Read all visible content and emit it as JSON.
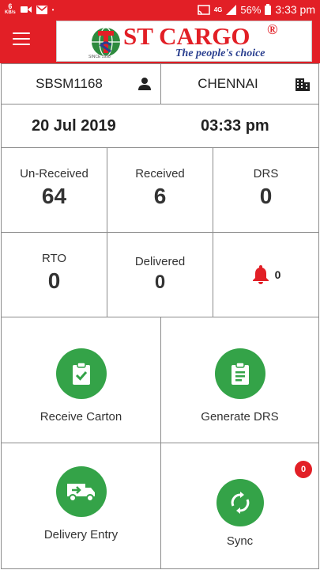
{
  "status_bar": {
    "net_speed": "6",
    "net_speed_unit": "KB/s",
    "network": "4G",
    "battery": "56%",
    "time": "3:33 pm"
  },
  "app_bar": {
    "logo_text": "ST CARGO",
    "logo_reg": "®",
    "logo_tagline": "The people's choice",
    "logo_since": "SINCE 1998"
  },
  "header": {
    "user_id": "SBSM1168",
    "branch": "CHENNAI",
    "date": "20 Jul 2019",
    "time": "03:33 pm"
  },
  "stats": {
    "unreceived_label": "Un-Received",
    "unreceived_value": "64",
    "received_label": "Received",
    "received_value": "6",
    "drs_label": "DRS",
    "drs_value": "0",
    "rto_label": "RTO",
    "rto_value": "0",
    "delivered_label": "Delivered",
    "delivered_value": "0",
    "notification_count": "0"
  },
  "actions": {
    "receive_carton": "Receive Carton",
    "generate_drs": "Generate DRS",
    "delivery_entry": "Delivery Entry",
    "sync": "Sync",
    "sync_badge": "0"
  },
  "colors": {
    "brand_red": "#e21f26",
    "action_green": "#34a348",
    "tagline_blue": "#2a3f8f"
  }
}
